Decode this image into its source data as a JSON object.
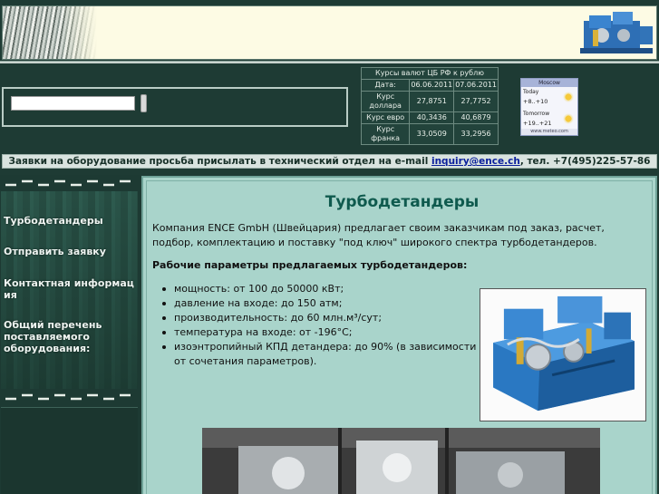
{
  "currency": {
    "caption": "Курсы валют ЦБ РФ к рублю",
    "date_label": "Дата:",
    "dates": [
      "06.06.2011",
      "07.06.2011"
    ],
    "rows": [
      {
        "label": "Курс доллара",
        "values": [
          "27,8751",
          "27,7752"
        ]
      },
      {
        "label": "Курс евро",
        "values": [
          "40,3436",
          "40,6879"
        ]
      },
      {
        "label": "Курс франка",
        "values": [
          "33,0509",
          "33,2956"
        ]
      }
    ]
  },
  "weather": {
    "city": "Moscow",
    "today_label": "Today",
    "today_temp": "+8..+10",
    "tomorrow_label": "Tomorrow",
    "tomorrow_temp": "+19..+21",
    "source": "www.meteo.com"
  },
  "notice": {
    "prefix": "Заявки на оборудование просьба присылать в технический отдел на e-mail ",
    "email": "inquiry@ence.ch",
    "suffix": ", тел. +7(495)225-57-86"
  },
  "sidebar": {
    "items": [
      {
        "label": "Турбодетандеры"
      },
      {
        "label": "Отправить заявку"
      },
      {
        "label": "Контактная информация"
      },
      {
        "label": "Общий перечень поставляемого оборудования:"
      }
    ]
  },
  "main": {
    "title": "Турбодетандеры",
    "intro": "Компания ENCE GmbH (Швейцария) предлагает своим заказчикам под заказ, расчет, подбор, комплектацию и поставку \"под ключ\" широкого спектра турбодетандеров.",
    "params_heading": "Рабочие параметры предлагаемых турбодетандеров:",
    "params": [
      "мощность: от 100 до 50000 кВт;",
      "давление на входе: до 150 атм;",
      "производительность: до 60 млн.м³/сут;",
      "температура на входе: от -196°С;",
      "изоэнтропийный КПД детандера: до 90% (в зависимости от сочетания параметров)."
    ]
  },
  "colors": {
    "page_bg": "#1e3b34",
    "main_bg": "#a9d4cb",
    "title": "#0f5a4e",
    "link": "#0a1f9c",
    "header_bg": "#fdfbe4"
  }
}
